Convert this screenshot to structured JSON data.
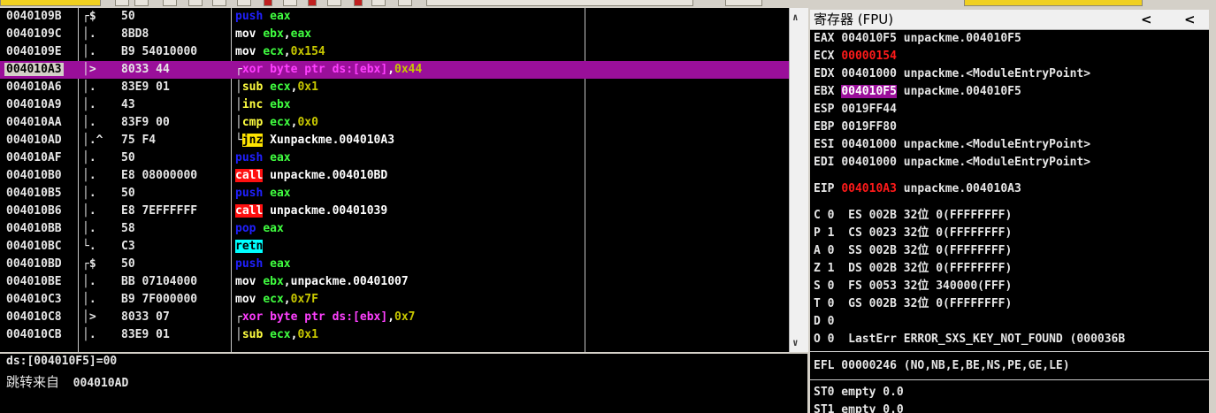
{
  "disasm": {
    "rows": [
      {
        "addr": "0040109B",
        "arrow": "┌$",
        "hex": "50",
        "mn": "push",
        "mcls": "m-push",
        "ops": [
          {
            "t": "eax",
            "c": "op-reg"
          }
        ]
      },
      {
        "addr": "0040109C",
        "arrow": "│.",
        "hex": "8BD8",
        "mn": "mov",
        "mcls": "m-mov",
        "ops": [
          {
            "t": "ebx",
            "c": "op-reg"
          },
          {
            "t": ",",
            "c": "op-w"
          },
          {
            "t": "eax",
            "c": "op-reg"
          }
        ]
      },
      {
        "addr": "0040109E",
        "arrow": "│.",
        "hex": "B9 54010000",
        "mn": "mov",
        "mcls": "m-mov",
        "ops": [
          {
            "t": "ecx",
            "c": "op-reg"
          },
          {
            "t": ",",
            "c": "op-w"
          },
          {
            "t": "0x154",
            "c": "op-num"
          }
        ]
      },
      {
        "addr": "004010A3",
        "arrow": "│>",
        "hex": "8033 44",
        "mn": "xor",
        "mcls": "m-xor",
        "ops": [
          {
            "t": "byte ptr ds:[ebx]",
            "c": "op-mem"
          },
          {
            "t": ",",
            "c": "op-w"
          },
          {
            "t": "0x44",
            "c": "op-num"
          }
        ],
        "selected": true,
        "boxed": true,
        "bracket": "┌"
      },
      {
        "addr": "004010A6",
        "arrow": "│.",
        "hex": "83E9 01",
        "mn": "sub",
        "mcls": "m-arith",
        "ops": [
          {
            "t": "ecx",
            "c": "op-reg"
          },
          {
            "t": ",",
            "c": "op-w"
          },
          {
            "t": "0x1",
            "c": "op-num"
          }
        ],
        "bracket": "│"
      },
      {
        "addr": "004010A9",
        "arrow": "│.",
        "hex": "43",
        "mn": "inc",
        "mcls": "m-arith",
        "ops": [
          {
            "t": "ebx",
            "c": "op-reg"
          }
        ],
        "bracket": "│"
      },
      {
        "addr": "004010AA",
        "arrow": "│.",
        "hex": "83F9 00",
        "mn": "cmp",
        "mcls": "m-arith",
        "ops": [
          {
            "t": "ecx",
            "c": "op-reg"
          },
          {
            "t": ",",
            "c": "op-w"
          },
          {
            "t": "0x0",
            "c": "op-num"
          }
        ],
        "bracket": "│"
      },
      {
        "addr": "004010AD",
        "arrow": "│.^",
        "hex": "75 F4",
        "mn": "jnz",
        "mcls": "m-jnz",
        "ops": [
          {
            "t": "Xunpackme.004010A3",
            "c": "op-w"
          }
        ],
        "bracket": "└"
      },
      {
        "addr": "004010AF",
        "arrow": "│.",
        "hex": "50",
        "mn": "push",
        "mcls": "m-push",
        "ops": [
          {
            "t": "eax",
            "c": "op-reg"
          }
        ]
      },
      {
        "addr": "004010B0",
        "arrow": "│.",
        "hex": "E8 08000000",
        "mn": "call",
        "mcls": "m-call",
        "ops": [
          {
            "t": "unpackme.004010BD",
            "c": "op-w"
          }
        ]
      },
      {
        "addr": "004010B5",
        "arrow": "│.",
        "hex": "50",
        "mn": "push",
        "mcls": "m-push",
        "ops": [
          {
            "t": "eax",
            "c": "op-reg"
          }
        ]
      },
      {
        "addr": "004010B6",
        "arrow": "│.",
        "hex": "E8 7EFFFFFF",
        "mn": "call",
        "mcls": "m-call",
        "ops": [
          {
            "t": "unpackme.00401039",
            "c": "op-w"
          }
        ]
      },
      {
        "addr": "004010BB",
        "arrow": "│.",
        "hex": "58",
        "mn": "pop",
        "mcls": "m-push",
        "ops": [
          {
            "t": "eax",
            "c": "op-reg"
          }
        ]
      },
      {
        "addr": "004010BC",
        "arrow": "└.",
        "hex": "C3",
        "mn": "retn",
        "mcls": "m-retn",
        "ops": []
      },
      {
        "addr": "004010BD",
        "arrow": "┌$",
        "hex": "50",
        "mn": "push",
        "mcls": "m-push",
        "ops": [
          {
            "t": "eax",
            "c": "op-reg"
          }
        ]
      },
      {
        "addr": "004010BE",
        "arrow": "│.",
        "hex": "BB 07104000",
        "mn": "mov",
        "mcls": "m-mov",
        "ops": [
          {
            "t": "ebx",
            "c": "op-reg"
          },
          {
            "t": ",",
            "c": "op-w"
          },
          {
            "t": "unpackme.00401007",
            "c": "op-w"
          }
        ]
      },
      {
        "addr": "004010C3",
        "arrow": "│.",
        "hex": "B9 7F000000",
        "mn": "mov",
        "mcls": "m-mov",
        "ops": [
          {
            "t": "ecx",
            "c": "op-reg"
          },
          {
            "t": ",",
            "c": "op-w"
          },
          {
            "t": "0x7F",
            "c": "op-num"
          }
        ]
      },
      {
        "addr": "004010C8",
        "arrow": "│>",
        "hex": "8033 07",
        "mn": "xor",
        "mcls": "m-xor",
        "ops": [
          {
            "t": "byte ptr ds:[ebx]",
            "c": "op-mem"
          },
          {
            "t": ",",
            "c": "op-w"
          },
          {
            "t": "0x7",
            "c": "op-num"
          }
        ],
        "bracket": "┌"
      },
      {
        "addr": "004010CB",
        "arrow": "│.",
        "hex": "83E9 01",
        "mn": "sub",
        "mcls": "m-arith",
        "ops": [
          {
            "t": "ecx",
            "c": "op-reg"
          },
          {
            "t": ",",
            "c": "op-w"
          },
          {
            "t": "0x1",
            "c": "op-num"
          }
        ],
        "bracket": "│"
      }
    ]
  },
  "info": {
    "line1": "ds:[004010F5]=00",
    "line2_label": "跳转来自",
    "line2_value": "004010AD"
  },
  "registers": {
    "title": "寄存器 (FPU)",
    "prev": "<",
    "next": "<",
    "eax": {
      "name": "EAX",
      "value": "004010F5",
      "comment": "unpackme.004010F5"
    },
    "ecx": {
      "name": "ECX",
      "value": "00000154",
      "comment": ""
    },
    "edx": {
      "name": "EDX",
      "value": "00401000",
      "comment": "unpackme.<ModuleEntryPoint>"
    },
    "ebx": {
      "name": "EBX",
      "value": "004010F5",
      "comment": "unpackme.004010F5"
    },
    "esp": {
      "name": "ESP",
      "value": "0019FF44",
      "comment": ""
    },
    "ebp": {
      "name": "EBP",
      "value": "0019FF80",
      "comment": ""
    },
    "esi": {
      "name": "ESI",
      "value": "00401000",
      "comment": "unpackme.<ModuleEntryPoint>"
    },
    "edi": {
      "name": "EDI",
      "value": "00401000",
      "comment": "unpackme.<ModuleEntryPoint>"
    },
    "eip": {
      "name": "EIP",
      "value": "004010A3",
      "comment": "unpackme.004010A3"
    },
    "flags": [
      "C 0  ES 002B 32位 0(FFFFFFFF)",
      "P 1  CS 0023 32位 0(FFFFFFFF)",
      "A 0  SS 002B 32位 0(FFFFFFFF)",
      "Z 1  DS 002B 32位 0(FFFFFFFF)",
      "S 0  FS 0053 32位 340000(FFF)",
      "T 0  GS 002B 32位 0(FFFFFFFF)",
      "D 0",
      "O 0  LastErr ERROR_SXS_KEY_NOT_FOUND (000036B"
    ],
    "efl": "EFL 00000246 (NO,NB,E,BE,NS,PE,GE,LE)",
    "st0": "ST0 empty 0.0",
    "st1": "ST1 empty 0.0"
  },
  "colors": {
    "selection": "#9a0f9a",
    "changed": "#ff1a1a",
    "background": "#000000"
  }
}
